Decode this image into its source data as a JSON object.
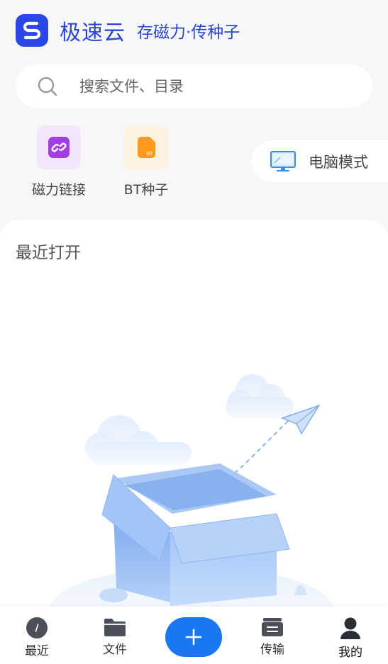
{
  "header": {
    "app_name": "极速云",
    "slogan": "存磁力·传种子",
    "brand_color": "#2b47e6"
  },
  "search": {
    "placeholder": "搜索文件、目录"
  },
  "shortcuts": [
    {
      "label": "磁力链接",
      "icon": "magnet-link-icon",
      "color": "#a13fe0"
    },
    {
      "label": "BT种子",
      "icon": "bt-file-icon",
      "color": "#ff9a1a"
    }
  ],
  "pc_mode": {
    "label": "电脑模式",
    "icon": "monitor-icon"
  },
  "recent": {
    "title": "最近打开"
  },
  "tabbar": {
    "items": [
      {
        "label": "最近",
        "icon": "recent-icon"
      },
      {
        "label": "文件",
        "icon": "folder-icon"
      },
      {
        "label": "传输",
        "icon": "transfer-icon"
      },
      {
        "label": "我的",
        "icon": "user-icon"
      }
    ],
    "add_icon": "plus-icon",
    "accent": "#1878f2"
  }
}
